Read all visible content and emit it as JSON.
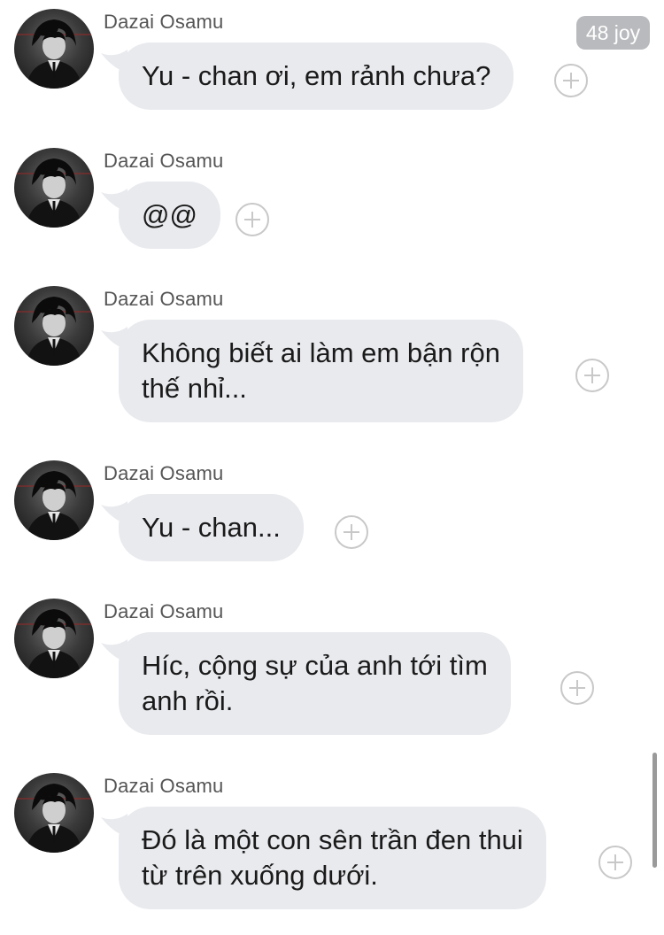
{
  "badge": {
    "joy": "48 joy"
  },
  "messages": [
    {
      "sender": "Dazai Osamu",
      "text": "Yu - chan ơi, em rảnh chưa?"
    },
    {
      "sender": "Dazai Osamu",
      "text": "@@"
    },
    {
      "sender": "Dazai Osamu",
      "text": "Không biết ai làm em bận rộn\nthế nhỉ..."
    },
    {
      "sender": "Dazai Osamu",
      "text": "Yu - chan..."
    },
    {
      "sender": "Dazai Osamu",
      "text": "Híc, cộng sự của anh tới tìm\nanh rồi."
    },
    {
      "sender": "Dazai Osamu",
      "text": "Đó là một con sên trần đen thui\ntừ trên xuống dưới."
    }
  ],
  "colors": {
    "bubble": "#e9eaee",
    "badge": "#b9babd",
    "plus_icon": "#c8c8c8"
  },
  "icons": {
    "avatar": "avatar-image",
    "react": "plus-circle-icon"
  }
}
